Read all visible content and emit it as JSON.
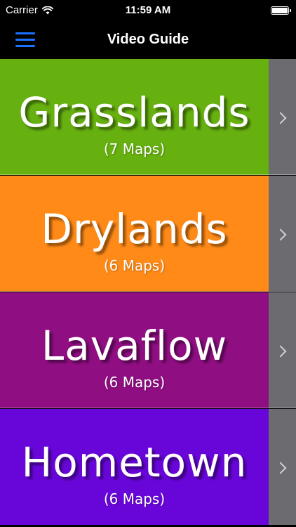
{
  "status_bar": {
    "carrier": "Carrier",
    "time": "11:59 AM",
    "icons": [
      "wifi-icon",
      "battery-icon"
    ]
  },
  "nav": {
    "title": "Video Guide",
    "menu_icon": "hamburger-menu-icon",
    "menu_color": "#1a73ff"
  },
  "rows": [
    {
      "title": "Grasslands",
      "subtitle": "(7 Maps)",
      "color": "#66b010"
    },
    {
      "title": "Drylands",
      "subtitle": "(6 Maps)",
      "color": "#ff8a17"
    },
    {
      "title": "Lavaflow",
      "subtitle": "(6 Maps)",
      "color": "#8f0e82"
    },
    {
      "title": "Hometown",
      "subtitle": "(6 Maps)",
      "color": "#6806da"
    }
  ],
  "colors": {
    "accessory": "#6b6b70",
    "chevron": "#cfcfd4"
  }
}
